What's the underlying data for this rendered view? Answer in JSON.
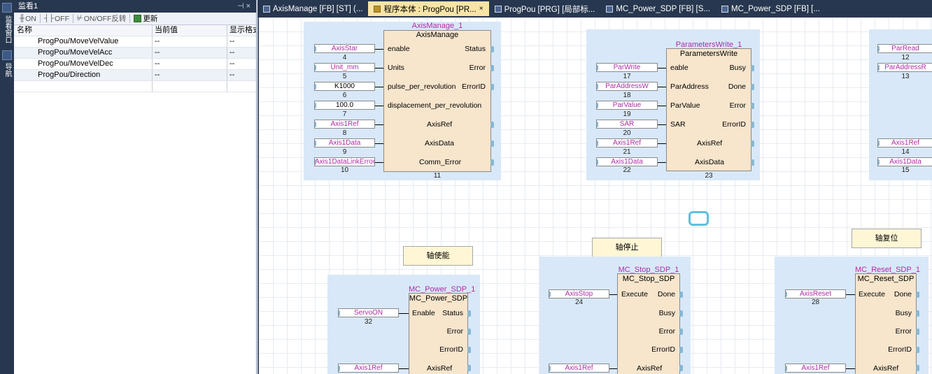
{
  "sidebar_strip": {
    "label1": "监看窗口",
    "label2": "导航"
  },
  "monitor": {
    "title": "监看1",
    "pin": "⊣ ×",
    "toolbar": {
      "on": "ON",
      "off": "OFF",
      "toggle": "ON/OFF反转",
      "update": "更新"
    },
    "columns": [
      "名称",
      "当前值",
      "显示格式"
    ],
    "rows": [
      {
        "name": "ProgPou/MoveVelValue",
        "value": "--",
        "fmt": "--"
      },
      {
        "name": "ProgPou/MoveVelAcc",
        "value": "--",
        "fmt": "--"
      },
      {
        "name": "ProgPou/MoveVelDec",
        "value": "--",
        "fmt": "--"
      },
      {
        "name": "ProgPou/Direction",
        "value": "--",
        "fmt": "--"
      },
      {
        "name": "",
        "value": "",
        "fmt": ""
      }
    ]
  },
  "tabs": [
    {
      "label": "AxisManage [FB] [ST] (...",
      "active": false
    },
    {
      "label": "程序本体 : ProgPou [PR...",
      "active": true
    },
    {
      "label": "ProgPou [PRG] [局部标...",
      "active": false
    },
    {
      "label": "MC_Power_SDP [FB] [S...",
      "active": false
    },
    {
      "label": "MC_Power_SDP [FB] [...",
      "active": false
    }
  ],
  "fb_axismanage": {
    "instance": "AxisManage_1",
    "type": "AxisManage",
    "step": "11",
    "inputs": [
      {
        "var": "AxisStar",
        "num": "4",
        "pin": "enable"
      },
      {
        "var": "Unit_mm",
        "num": "5",
        "pin": "Units"
      },
      {
        "var": "K1000",
        "num": "6",
        "pin": "pulse_per_revolution"
      },
      {
        "var": "100.0",
        "num": "7",
        "pin": "displacement_per_revolution"
      },
      {
        "var": "Axis1Ref",
        "num": "8",
        "pin": "AxisRef"
      },
      {
        "var": "Axis1Data",
        "num": "9",
        "pin": "AxisData"
      },
      {
        "var": "Axis1DataLinkError",
        "num": "10",
        "pin": "Comm_Error"
      }
    ],
    "outputs": [
      "Status",
      "Error",
      "ErrorID"
    ]
  },
  "fb_paramwrite": {
    "instance": "ParametersWrite_1",
    "type": "ParametersWrite",
    "step": "23",
    "inputs": [
      {
        "var": "ParWrite",
        "num": "17",
        "pin": "eable"
      },
      {
        "var": "ParAddressW",
        "num": "18",
        "pin": "ParAddress"
      },
      {
        "var": "ParValue",
        "num": "19",
        "pin": "ParValue"
      },
      {
        "var": "SAR",
        "num": "20",
        "pin": "SAR"
      },
      {
        "var": "Axis1Ref",
        "num": "21",
        "pin": "AxisRef"
      },
      {
        "var": "Axis1Data",
        "num": "22",
        "pin": "AxisData"
      }
    ],
    "outputs": [
      "Busy",
      "Done",
      "Error",
      "ErrorID"
    ]
  },
  "fb_paramread_partial": {
    "inputs": [
      {
        "var": "ParRead",
        "num": "12"
      },
      {
        "var": "ParAddressR",
        "num": "13"
      },
      {
        "var": "Axis1Ref",
        "num": "14"
      },
      {
        "var": "Axis1Data",
        "num": "15"
      }
    ]
  },
  "comments": {
    "enable": "轴使能",
    "stop": "轴停止",
    "reset": "轴复位"
  },
  "fb_power": {
    "instance": "MC_Power_SDP_1",
    "type": "MC_Power_SDP",
    "inputs": [
      {
        "var": "ServoON",
        "num": "32",
        "pin": "Enable"
      },
      {
        "var": "Axis1Ref",
        "num": "",
        "pin": "AxisRef"
      }
    ],
    "outputs": [
      "Status",
      "Error",
      "ErrorID"
    ]
  },
  "fb_stop": {
    "instance": "MC_Stop_SDP_1",
    "type": "MC_Stop_SDP",
    "inputs": [
      {
        "var": "AxisStop",
        "num": "24",
        "pin": "Execute"
      },
      {
        "var": "Axis1Ref",
        "num": "",
        "pin": "AxisRef"
      }
    ],
    "outputs": [
      "Done",
      "Busy",
      "Error",
      "ErrorID"
    ]
  },
  "fb_reset": {
    "instance": "MC_Reset_SDP_1",
    "type": "MC_Reset_SDP",
    "inputs": [
      {
        "var": "AxisReset",
        "num": "28",
        "pin": "Execute"
      },
      {
        "var": "Axis1Ref",
        "num": "",
        "pin": "AxisRef"
      }
    ],
    "outputs": [
      "Done",
      "Busy",
      "Error",
      "ErrorID"
    ]
  }
}
